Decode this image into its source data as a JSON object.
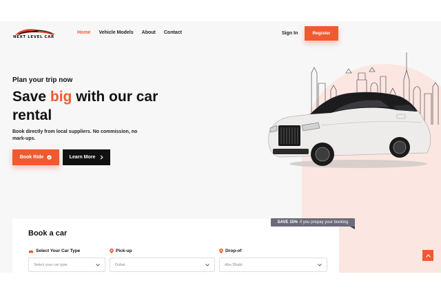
{
  "brand": {
    "logo_text": "NEXT LEVEL CAR",
    "accent": "#f05a30"
  },
  "nav": {
    "items": [
      {
        "label": "Home",
        "active": true
      },
      {
        "label": "Vehicle Models",
        "active": false
      },
      {
        "label": "About",
        "active": false
      },
      {
        "label": "Contact",
        "active": false
      }
    ],
    "signin": "Sign In",
    "register": "Register"
  },
  "hero": {
    "eyebrow": "Plan your trip now",
    "headline_part1": "Save ",
    "headline_highlight": "big",
    "headline_part2": " with our car rental",
    "subtext": "Book directly from local suppliers. No commission, no mark-ups.",
    "book_ride": "Book Ride",
    "learn_more": "Learn More"
  },
  "booking": {
    "title": "Book a car",
    "badge_bold": "SAVE 15%",
    "badge_rest": "if you prepay your booking",
    "fields": [
      {
        "label": "Select Your Car Type",
        "value": "Select your car type",
        "icon": "car-icon"
      },
      {
        "label": "Pick-up",
        "value": "Dubai",
        "icon": "location-pin-icon"
      },
      {
        "label": "Drop-of",
        "value": "Abu Dhabi",
        "icon": "location-pin-icon"
      }
    ]
  },
  "scroll_top_icon": "chevron-up-icon"
}
